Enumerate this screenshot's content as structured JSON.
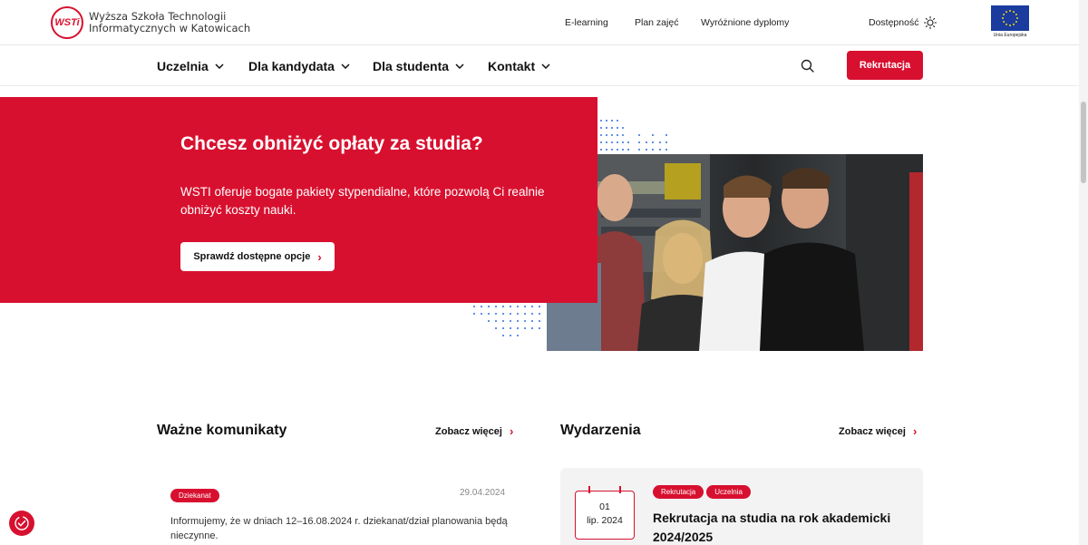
{
  "header": {
    "logo_mark": "WSTi",
    "logo_line1": "Wyższa Szkoła Technologii",
    "logo_line2": "Informatycznych w Katowicach",
    "links": [
      "E-learning",
      "Plan zajęć",
      "Wyróżnione dyplomy"
    ],
    "accessibility_label": "Dostępność",
    "eu_label": "Unia Europejska"
  },
  "nav": {
    "items": [
      "Uczelnia",
      "Dla kandydata",
      "Dla studenta",
      "Kontakt"
    ],
    "cta_label": "Rekrutacja",
    "search_icon": "search-icon"
  },
  "hero": {
    "title": "Chcesz obniżyć opłaty za studia?",
    "description": "WSTI oferuje bogate pakiety stypendialne, które pozwolą Ci realnie obniżyć koszty nauki.",
    "button_label": "Sprawdź dostępne opcje"
  },
  "announcements": {
    "title": "Ważne komunikaty",
    "more_label": "Zobacz więcej",
    "items": [
      {
        "tag": "Dziekanat",
        "date": "29.04.2024",
        "text": "Informujemy, że w dniach 12–16.08.2024 r. dziekanat/dział planowania będą nieczynne."
      }
    ]
  },
  "events": {
    "title": "Wydarzenia",
    "more_label": "Zobacz więcej",
    "items": [
      {
        "day": "01",
        "month": "lip. 2024",
        "tags": [
          "Rekrutacja",
          "Uczelnia"
        ],
        "title": "Rekrutacja na studia na rok akademicki 2024/2025"
      }
    ]
  },
  "colors": {
    "accent": "#d8102f",
    "text": "#111111",
    "card_bg": "#f3f3f4"
  }
}
